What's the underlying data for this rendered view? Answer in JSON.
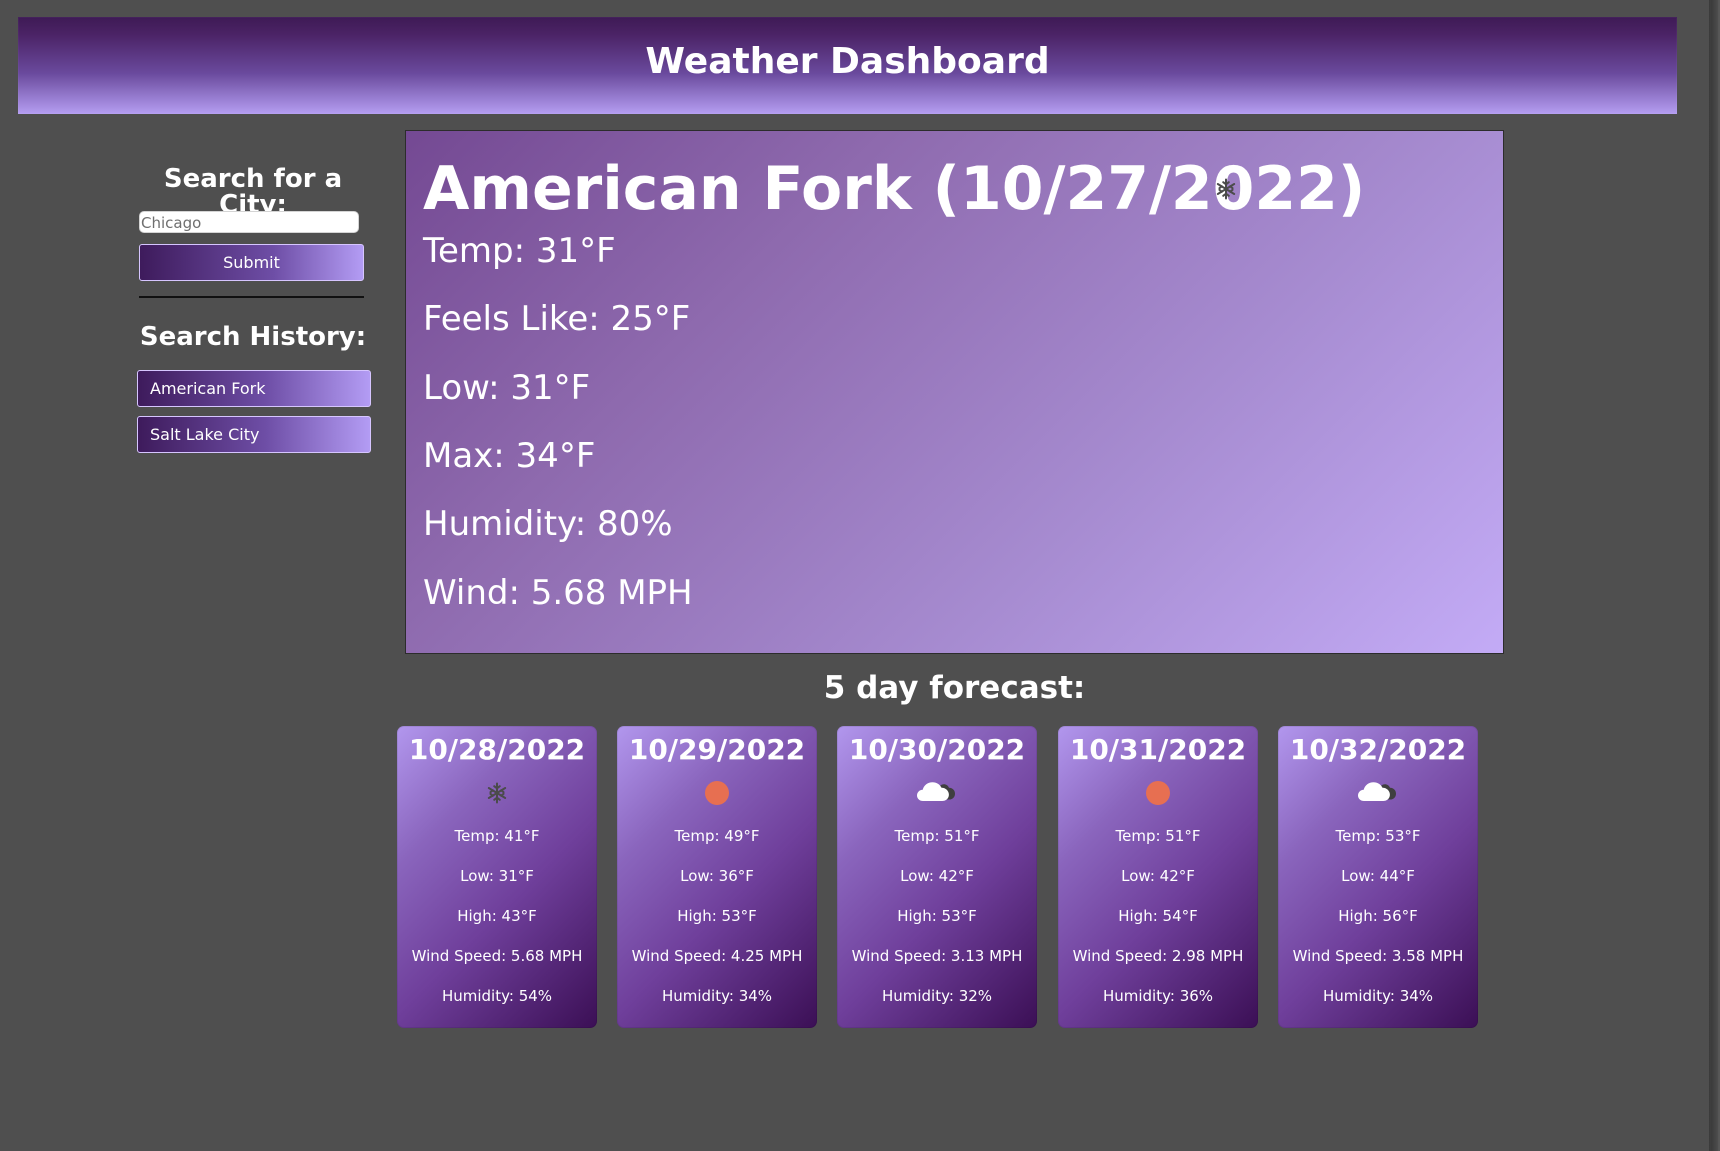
{
  "header": {
    "title": "Weather Dashboard"
  },
  "sidebar": {
    "search_title": "Search for a City:",
    "search_value": "Chicago",
    "submit_label": "Submit",
    "history_title": "Search History:",
    "history": [
      "American Fork",
      "Salt Lake City"
    ]
  },
  "current": {
    "title": "American Fork (10/27/2022)",
    "icon": "snowflake-icon",
    "temp": "Temp: 31°F",
    "feels_like": "Feels Like: 25°F",
    "low": "Low: 31°F",
    "max": "Max: 34°F",
    "humidity": "Humidity: 80%",
    "wind": "Wind: 5.68 MPH"
  },
  "forecast": {
    "title": "5 day forecast:",
    "days": [
      {
        "date": "10/28/2022",
        "icon": "snowflake-icon",
        "temp": "Temp: 41°F",
        "low": "Low: 31°F",
        "high": "High: 43°F",
        "wind": "Wind Speed: 5.68 MPH",
        "humidity": "Humidity: 54%"
      },
      {
        "date": "10/29/2022",
        "icon": "sun-icon",
        "temp": "Temp: 49°F",
        "low": "Low: 36°F",
        "high": "High: 53°F",
        "wind": "Wind Speed: 4.25 MPH",
        "humidity": "Humidity: 34%"
      },
      {
        "date": "10/30/2022",
        "icon": "cloud-icon",
        "temp": "Temp: 51°F",
        "low": "Low: 42°F",
        "high": "High: 53°F",
        "wind": "Wind Speed: 3.13 MPH",
        "humidity": "Humidity: 32%"
      },
      {
        "date": "10/31/2022",
        "icon": "sun-icon",
        "temp": "Temp: 51°F",
        "low": "Low: 42°F",
        "high": "High: 54°F",
        "wind": "Wind Speed: 2.98 MPH",
        "humidity": "Humidity: 36%"
      },
      {
        "date": "10/32/2022",
        "icon": "cloud-icon",
        "temp": "Temp: 53°F",
        "low": "Low: 44°F",
        "high": "High: 56°F",
        "wind": "Wind Speed: 3.58 MPH",
        "humidity": "Humidity: 34%"
      }
    ]
  },
  "colors": {
    "background": "#4f4f4f",
    "purple_dark": "#3e1a55",
    "purple_mid": "#8a65bd",
    "purple_light": "#c3abf6",
    "sun": "#e76f51",
    "icon_gray": "#4b4b4b",
    "cloud_white": "#ffffff"
  }
}
